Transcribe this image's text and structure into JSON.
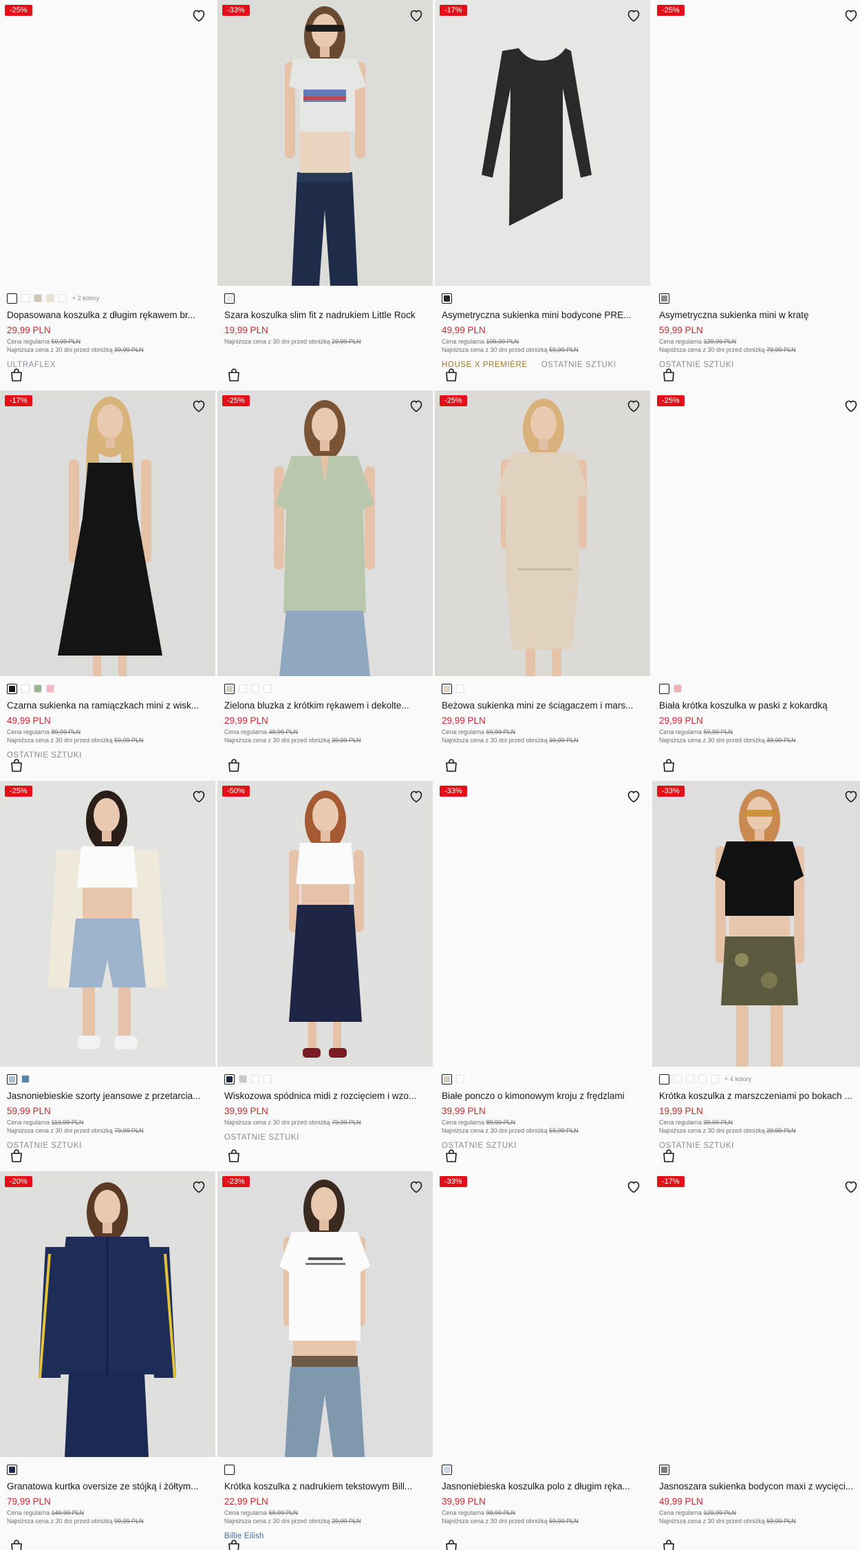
{
  "labels": {
    "regular_prefix": "Cena regularna",
    "lowest_prefix": "Najniższa cena z 30 dni przed obniżką"
  },
  "products": [
    {
      "badge": "-25%",
      "title": "Dopasowana koszulka z długim rękawem br...",
      "price": "29,99 PLN",
      "regular": "59,99 PLN",
      "lowest": "39,99 PLN",
      "swatches": [
        "#ffffff",
        "#ffffff",
        "#cfc7b3",
        "#e8e4d6",
        "#ffffff"
      ],
      "more_colors": "+ 2 kolory",
      "tags": [
        {
          "text": "ULTRAFLEX",
          "style": "brand"
        }
      ],
      "image": "blank"
    },
    {
      "badge": "-33%",
      "title": "Szara koszulka slim fit z nadrukiem Little Rock",
      "price": "19,99 PLN",
      "regular": "",
      "lowest": "29,99 PLN",
      "swatches": [
        "#e9ebe8"
      ],
      "more_colors": "",
      "tags": [],
      "image": "tee-grey"
    },
    {
      "badge": "-17%",
      "title": "Asymetryczna sukienka mini bodycone PRE...",
      "price": "49,99 PLN",
      "regular": "199,99 PLN",
      "lowest": "59,99 PLN",
      "swatches": [
        "#262626"
      ],
      "more_colors": "",
      "tags": [
        {
          "text": "HOUSE X PREMIÈRE",
          "style": "gold"
        },
        {
          "text": "OSTATNIE SZTUKI",
          "style": "plain"
        }
      ],
      "image": "dress-flat"
    },
    {
      "badge": "-25%",
      "title": "Asymetryczna sukienka mini w kratę",
      "price": "59,99 PLN",
      "regular": "129,99 PLN",
      "lowest": "79,99 PLN",
      "swatches": [
        "#8a8a8a"
      ],
      "more_colors": "",
      "tags": [
        {
          "text": "OSTATNIE SZTUKI",
          "style": "plain"
        }
      ],
      "image": "blank"
    },
    {
      "badge": "-17%",
      "title": "Czarna sukienka na ramiączkach mini z wisk...",
      "price": "49,99 PLN",
      "regular": "89,99 PLN",
      "lowest": "59,99 PLN",
      "swatches": [
        "#1a1a1a",
        "#ffffff",
        "#9bb38a",
        "#efb8c2"
      ],
      "more_colors": "",
      "tags": [
        {
          "text": "OSTATNIE SZTUKI",
          "style": "plain"
        }
      ],
      "image": "dress-black"
    },
    {
      "badge": "-25%",
      "title": "Zielona bluzka z krótkim rękawem i dekolte...",
      "price": "29,99 PLN",
      "regular": "49,99 PLN",
      "lowest": "39,99 PLN",
      "swatches": [
        "#c9d3bd",
        "#ffffff",
        "#ffffff",
        "#ffffff"
      ],
      "more_colors": "",
      "tags": [],
      "image": "blouse-green"
    },
    {
      "badge": "-25%",
      "title": "Beżowa sukienka mini ze ściągaczem i mars...",
      "price": "29,99 PLN",
      "regular": "69,99 PLN",
      "lowest": "39,99 PLN",
      "swatches": [
        "#e2d5c4",
        "#ffffff"
      ],
      "more_colors": "",
      "tags": [],
      "image": "dress-beige"
    },
    {
      "badge": "-25%",
      "title": "Biała krótka koszulka w paski z kokardką",
      "price": "29,99 PLN",
      "regular": "59,99 PLN",
      "lowest": "39,99 PLN",
      "swatches": [
        "#ffffff",
        "#efb0b6"
      ],
      "more_colors": "",
      "tags": [],
      "image": "blank"
    },
    {
      "badge": "-25%",
      "title": "Jasnoniebieskie szorty jeansowe z przetarcia...",
      "price": "59,99 PLN",
      "regular": "119,99 PLN",
      "lowest": "79,99 PLN",
      "swatches": [
        "#a6bfd8",
        "#5a84a8"
      ],
      "more_colors": "",
      "tags": [
        {
          "text": "OSTATNIE SZTUKI",
          "style": "plain"
        }
      ],
      "image": "shorts-denim"
    },
    {
      "badge": "-50%",
      "title": "Wiskozowa spódnica midi z rozcięciem i wzo...",
      "price": "39,99 PLN",
      "regular": "",
      "lowest": "79,99 PLN",
      "swatches": [
        "#1c2340",
        "#c9c9c9",
        "#ffffff",
        "#ffffff"
      ],
      "more_colors": "",
      "tags": [
        {
          "text": "OSTATNIE SZTUKI",
          "style": "plain"
        }
      ],
      "image": "skirt-navy"
    },
    {
      "badge": "-33%",
      "title": "Białe ponczo o kimonowym kroju z frędzlami",
      "price": "39,99 PLN",
      "regular": "89,99 PLN",
      "lowest": "59,99 PLN",
      "swatches": [
        "#d9ccc0",
        "#ffffff"
      ],
      "more_colors": "",
      "tags": [
        {
          "text": "OSTATNIE SZTUKI",
          "style": "plain"
        }
      ],
      "image": "blank"
    },
    {
      "badge": "-33%",
      "title": "Krótka koszulka z marszczeniami po bokach ...",
      "price": "19,99 PLN",
      "regular": "39,99 PLN",
      "lowest": "29,99 PLN",
      "swatches": [
        "#ffffff",
        "#ffffff",
        "#ffffff",
        "#ffffff",
        "#ffffff"
      ],
      "more_colors": "+ 4 kolory",
      "tags": [
        {
          "text": "OSTATNIE SZTUKI",
          "style": "plain"
        }
      ],
      "image": "tee-black-camo"
    },
    {
      "badge": "-20%",
      "title": "Granatowa kurtka oversize ze stójką i żółtym...",
      "price": "79,99 PLN",
      "regular": "149,99 PLN",
      "lowest": "99,99 PLN",
      "swatches": [
        "#1f2c4f"
      ],
      "more_colors": "",
      "tags": [],
      "image": "jacket-navy"
    },
    {
      "badge": "-23%",
      "title": "Krótka koszulka z nadrukiem tekstowym Bill...",
      "price": "22,99 PLN",
      "regular": "69,99 PLN",
      "lowest": "29,99 PLN",
      "swatches": [
        "#ffffff"
      ],
      "more_colors": "",
      "tags": [
        {
          "text": "Billie Eilish",
          "style": "blue"
        }
      ],
      "image": "tee-white-jeans"
    },
    {
      "badge": "-33%",
      "title": "Jasnoniebieska koszulka polo z długim ręka...",
      "price": "39,99 PLN",
      "regular": "99,99 PLN",
      "lowest": "59,99 PLN",
      "swatches": [
        "#c8d6e6"
      ],
      "more_colors": "",
      "tags": [],
      "image": "blank"
    },
    {
      "badge": "-17%",
      "title": "Jasnoszara sukienka bodycon maxi z wycięci...",
      "price": "49,99 PLN",
      "regular": "129,99 PLN",
      "lowest": "59,99 PLN",
      "swatches": [
        "#7c7c7c"
      ],
      "more_colors": "",
      "tags": [],
      "image": "blank"
    }
  ]
}
